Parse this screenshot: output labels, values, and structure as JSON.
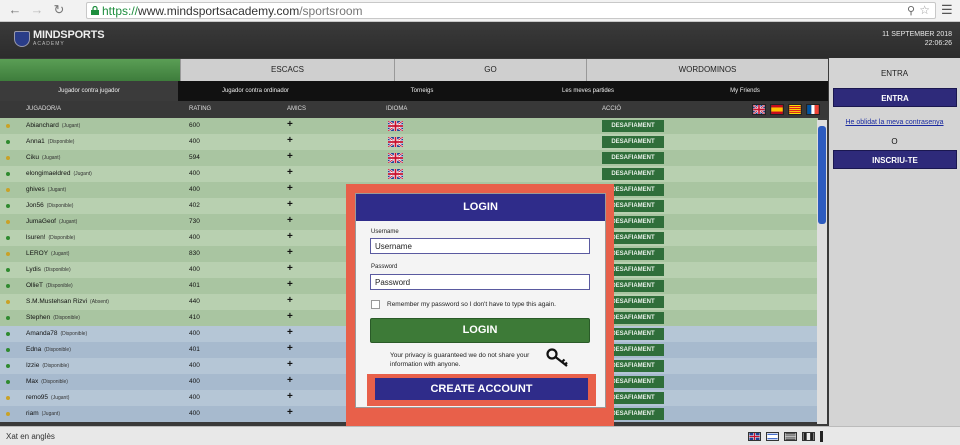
{
  "browser": {
    "url_proto": "https://",
    "url_domain": "www.mindsportsacademy.com",
    "url_path": "/sportsroom"
  },
  "header": {
    "logo_main": "MINDSPORTS",
    "logo_sub": "ACADEMY",
    "date": "11 SEPTEMBER 2018",
    "time": "22:06:26"
  },
  "game_tabs": [
    "ESCACS",
    "GO",
    "WORDOMINOS"
  ],
  "sub_tabs": [
    "Jugador contra jugador",
    "Jugador contra ordinador",
    "Torneigs",
    "Les meves partides",
    "My Friends"
  ],
  "columns": {
    "player": "JUGADOR/A",
    "rating": "RATING",
    "friends": "AMICS",
    "language": "IDIOMA",
    "action": "ACCIÓ"
  },
  "challenge_label": "DESAFIAMENT",
  "plus_label": "+",
  "players": [
    {
      "name": "Abianchard",
      "status": "(Jugant)",
      "rating": "600",
      "dot": "#c9a227"
    },
    {
      "name": "Anna1",
      "status": "(Disponible)",
      "rating": "400",
      "dot": "#2f8a2f"
    },
    {
      "name": "Ciku",
      "status": "(Jugant)",
      "rating": "594",
      "dot": "#c9a227"
    },
    {
      "name": "elongimaeldred",
      "status": "(Jugant)",
      "rating": "400",
      "dot": "#2f8a2f"
    },
    {
      "name": "ghives",
      "status": "(Jugant)",
      "rating": "400",
      "dot": "#c9a227"
    },
    {
      "name": "Jon56",
      "status": "(Disponible)",
      "rating": "402",
      "dot": "#2f8a2f"
    },
    {
      "name": "JumaGeof",
      "status": "(Jugant)",
      "rating": "730",
      "dot": "#c9a227"
    },
    {
      "name": "lsuren!",
      "status": "(Disponible)",
      "rating": "400",
      "dot": "#2f8a2f"
    },
    {
      "name": "LEROY",
      "status": "(Jugant)",
      "rating": "830",
      "dot": "#c9a227"
    },
    {
      "name": "Lydis",
      "status": "(Disponible)",
      "rating": "400",
      "dot": "#2f8a2f"
    },
    {
      "name": "OllieT",
      "status": "(Disponible)",
      "rating": "401",
      "dot": "#2f8a2f"
    },
    {
      "name": "S.M.Mustehsan Rizvi",
      "status": "(Absent)",
      "rating": "440",
      "dot": "#c9a227"
    },
    {
      "name": "Stephen",
      "status": "(Disponible)",
      "rating": "410",
      "dot": "#2f8a2f"
    },
    {
      "name": "Amanda78",
      "status": "(Disponible)",
      "rating": "400",
      "dot": "#2f8a2f"
    },
    {
      "name": "Edna",
      "status": "(Disponible)",
      "rating": "401",
      "dot": "#2f8a2f"
    },
    {
      "name": "Izzie",
      "status": "(Disponible)",
      "rating": "400",
      "dot": "#2f8a2f"
    },
    {
      "name": "Max",
      "status": "(Disponible)",
      "rating": "400",
      "dot": "#2f8a2f"
    },
    {
      "name": "remo95",
      "status": "(Jugant)",
      "rating": "400",
      "dot": "#c9a227"
    },
    {
      "name": "riam",
      "status": "(Jugant)",
      "rating": "400",
      "dot": "#c9a227"
    }
  ],
  "right_panel": {
    "title": "ENTRA",
    "enter_button": "ENTRA",
    "forgot_link": "He oblidat la meva contrasenya",
    "or": "O",
    "register_button": "INSCRIU-TE"
  },
  "footer": {
    "chat_label": "Xat en anglès"
  },
  "login_modal": {
    "title": "LOGIN",
    "username_label": "Username",
    "username_value": "Username",
    "password_label": "Password",
    "password_value": "Password",
    "remember_text": "Remember my password so I don't have to type this again.",
    "login_button": "LOGIN",
    "privacy_text": "Your privacy is guaranteed we do not share your information with anyone.",
    "create_button": "CREATE ACCOUNT"
  },
  "colors": {
    "accent_blue": "#2f2c8a",
    "accent_green": "#3d7a37",
    "highlight": "#e8604a"
  }
}
